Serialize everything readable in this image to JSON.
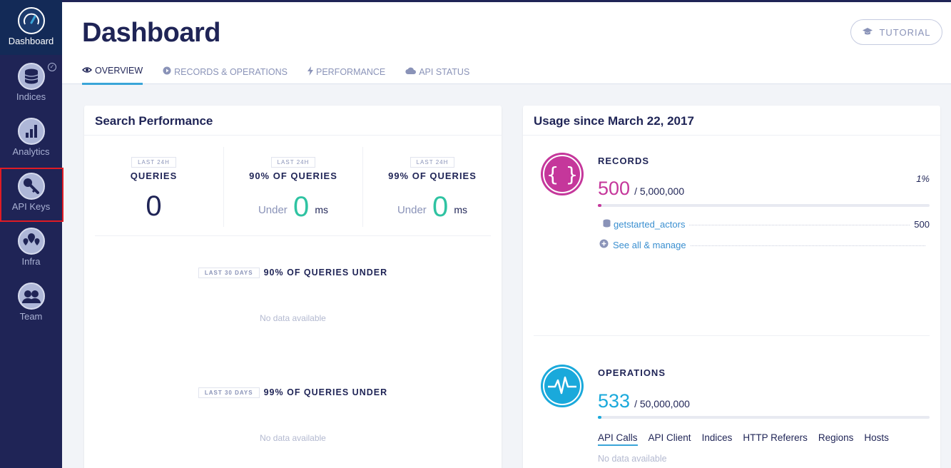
{
  "sidebar": {
    "items": [
      {
        "label": "Dashboard"
      },
      {
        "label": "Indices"
      },
      {
        "label": "Analytics"
      },
      {
        "label": "API Keys"
      },
      {
        "label": "Infra"
      },
      {
        "label": "Team"
      }
    ]
  },
  "header": {
    "title": "Dashboard",
    "tutorial_label": "TUTORIAL",
    "tabs": [
      {
        "label": "OVERVIEW"
      },
      {
        "label": "RECORDS & OPERATIONS"
      },
      {
        "label": "PERFORMANCE"
      },
      {
        "label": "API STATUS"
      }
    ]
  },
  "search_performance": {
    "title": "Search Performance",
    "stats": [
      {
        "badge": "LAST 24H",
        "label": "QUERIES",
        "value": "0"
      },
      {
        "badge": "LAST 24H",
        "label": "90% OF QUERIES",
        "prefix": "Under",
        "value": "0",
        "unit": "ms"
      },
      {
        "badge": "LAST 24H",
        "label": "99% OF QUERIES",
        "prefix": "Under",
        "value": "0",
        "unit": "ms"
      }
    ],
    "sections": [
      {
        "badge": "LAST 30 DAYS",
        "label": "90% OF QUERIES UNDER",
        "empty": "No data available"
      },
      {
        "badge": "LAST 30 DAYS",
        "label": "99% OF QUERIES UNDER",
        "empty": "No data available"
      }
    ]
  },
  "usage": {
    "title": "Usage since March 22, 2017",
    "records": {
      "label": "RECORDS",
      "value": "500",
      "total": "/ 5,000,000",
      "percent": "1%",
      "fill_fraction": 0.01,
      "color": "#c5379b",
      "index_name": "getstarted_actors",
      "index_count": "500",
      "manage_link": "See all & manage"
    },
    "operations": {
      "label": "OPERATIONS",
      "value": "533",
      "total": "/ 50,000,000",
      "fill_fraction": 0.01,
      "color": "#1aa9db",
      "tabs": [
        "API Calls",
        "API Client",
        "Indices",
        "HTTP Referers",
        "Regions",
        "Hosts"
      ],
      "empty": "No data available"
    }
  }
}
